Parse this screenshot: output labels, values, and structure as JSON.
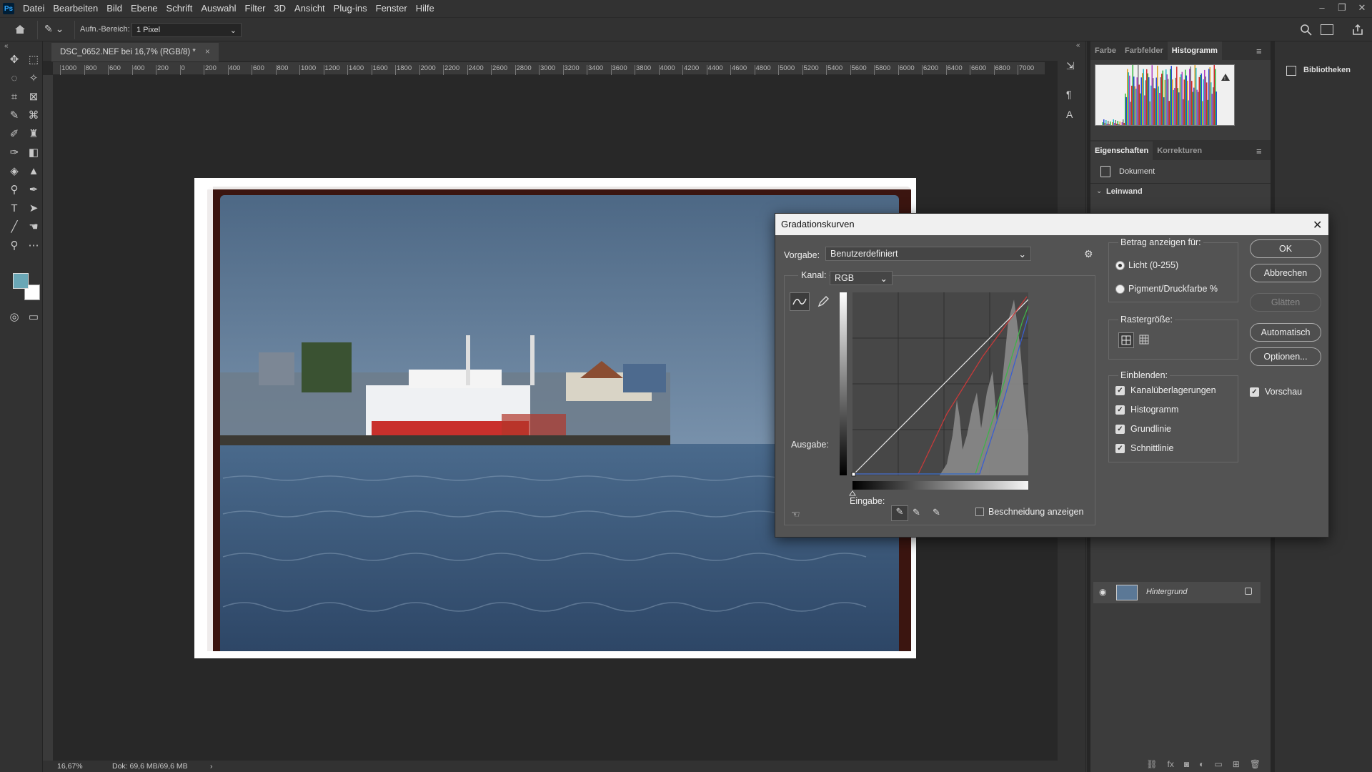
{
  "menu": {
    "logo": "Ps",
    "items": [
      "Datei",
      "Bearbeiten",
      "Bild",
      "Ebene",
      "Schrift",
      "Auswahl",
      "Filter",
      "3D",
      "Ansicht",
      "Plug-ins",
      "Fenster",
      "Hilfe"
    ]
  },
  "options": {
    "sample_label": "Aufn.-Bereich:",
    "sample_value": "1 Pixel"
  },
  "document": {
    "tab_title": "DSC_0652.NEF bei 16,7% (RGB/8) *",
    "close": "×"
  },
  "ruler": {
    "labels": [
      "1000",
      "800",
      "600",
      "400",
      "200",
      "0",
      "200",
      "400",
      "600",
      "800",
      "1000",
      "1200",
      "1400",
      "1600",
      "1800",
      "2000",
      "2200",
      "2400",
      "2600",
      "2800",
      "3000",
      "3200",
      "3400",
      "3600",
      "3800",
      "4000",
      "4200",
      "4400",
      "4600",
      "4800",
      "5000",
      "5200",
      "5400",
      "5600",
      "5800",
      "6000",
      "6200",
      "6400",
      "6600",
      "6800",
      "7000"
    ]
  },
  "status": {
    "zoom": "16,67%",
    "doc": "Dok: 69,6 MB/69,6 MB",
    "arrow": "›"
  },
  "panels": {
    "top_tabs": [
      "Farbe",
      "Farbfelder",
      "Histogramm"
    ],
    "props_tabs": [
      "Eigenschaften",
      "Korrekturen"
    ],
    "doc_label": "Dokument",
    "canvas_section": "Leinwand",
    "libraries": "Bibliotheken",
    "layer_name": "Hintergrund"
  },
  "dialog": {
    "title": "Gradationskurven",
    "preset_label": "Vorgabe:",
    "preset_value": "Benutzerdefiniert",
    "channel_label": "Kanal:",
    "channel_value": "RGB",
    "output_label": "Ausgabe:",
    "input_label": "Eingabe:",
    "show_clipping": "Beschneidung anzeigen",
    "show_amount_title": "Betrag anzeigen für:",
    "light_option": "Licht (0-255)",
    "pigment_option": "Pigment/Druckfarbe %",
    "grid_size_title": "Rastergröße:",
    "show_title": "Einblenden:",
    "show_options": [
      "Kanalüberlagerungen",
      "Histogramm",
      "Grundlinie",
      "Schnittlinie"
    ],
    "buttons": {
      "ok": "OK",
      "cancel": "Abbrechen",
      "smooth": "Glätten",
      "auto": "Automatisch",
      "options": "Optionen..."
    },
    "preview": "Vorschau"
  }
}
